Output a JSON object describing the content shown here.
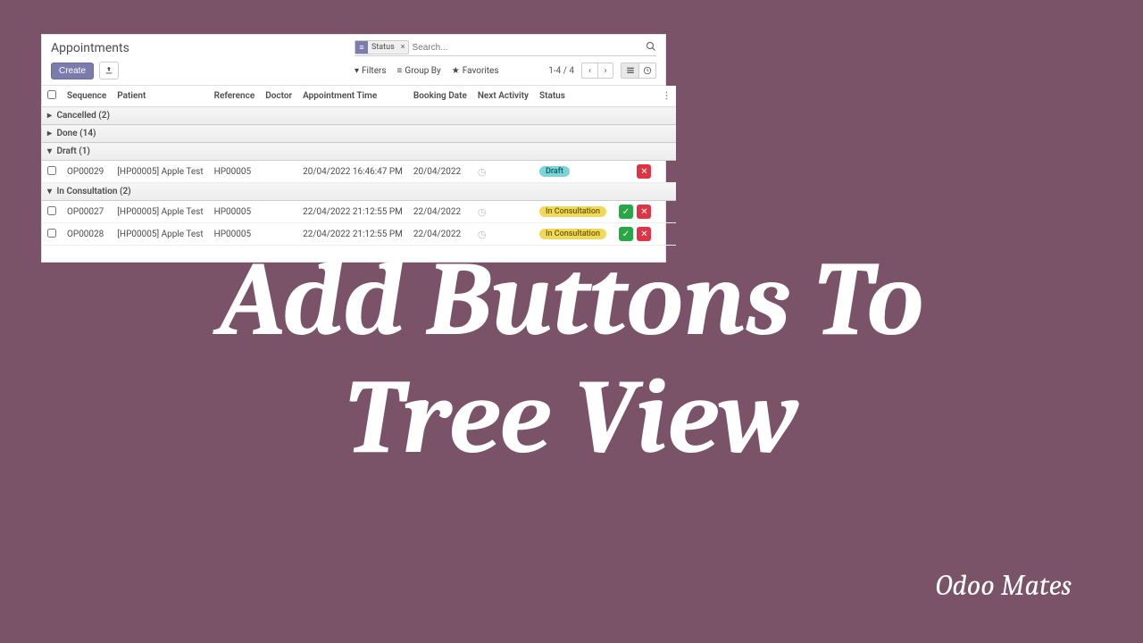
{
  "slide": {
    "title_line1": "Add Buttons To",
    "title_line2": "Tree View",
    "subtitle": "Odoo Mates"
  },
  "breadcrumb": "Appointments",
  "buttons": {
    "create": "Create"
  },
  "search": {
    "facet_label": "Status",
    "placeholder": "Search..."
  },
  "toolbar": {
    "filters": "Filters",
    "group_by": "Group By",
    "favorites": "Favorites"
  },
  "pager": "1-4 / 4",
  "columns": {
    "sequence": "Sequence",
    "patient": "Patient",
    "reference": "Reference",
    "doctor": "Doctor",
    "appt_time": "Appointment Time",
    "booking_date": "Booking Date",
    "next_activity": "Next Activity",
    "status": "Status"
  },
  "groups": [
    {
      "label": "Cancelled (2)",
      "expanded": false
    },
    {
      "label": "Done (14)",
      "expanded": false
    },
    {
      "label": "Draft (1)",
      "expanded": true
    },
    {
      "label": "In Consultation (2)",
      "expanded": true
    }
  ],
  "rows_draft": [
    {
      "sequence": "OP00029",
      "patient": "[HP00005] Apple Test",
      "reference": "HP00005",
      "doctor": "",
      "appt_time": "20/04/2022 16:46:47 PM",
      "booking_date": "20/04/2022",
      "status": "Draft",
      "status_kind": "draft",
      "has_ok": false
    }
  ],
  "rows_consult": [
    {
      "sequence": "OP00027",
      "patient": "[HP00005] Apple Test",
      "reference": "HP00005",
      "doctor": "",
      "appt_time": "22/04/2022 21:12:55 PM",
      "booking_date": "22/04/2022",
      "status": "In Consultation",
      "status_kind": "consult",
      "has_ok": true
    },
    {
      "sequence": "OP00028",
      "patient": "[HP00005] Apple Test",
      "reference": "HP00005",
      "doctor": "",
      "appt_time": "22/04/2022 21:12:55 PM",
      "booking_date": "22/04/2022",
      "status": "In Consultation",
      "status_kind": "consult",
      "has_ok": true
    }
  ]
}
